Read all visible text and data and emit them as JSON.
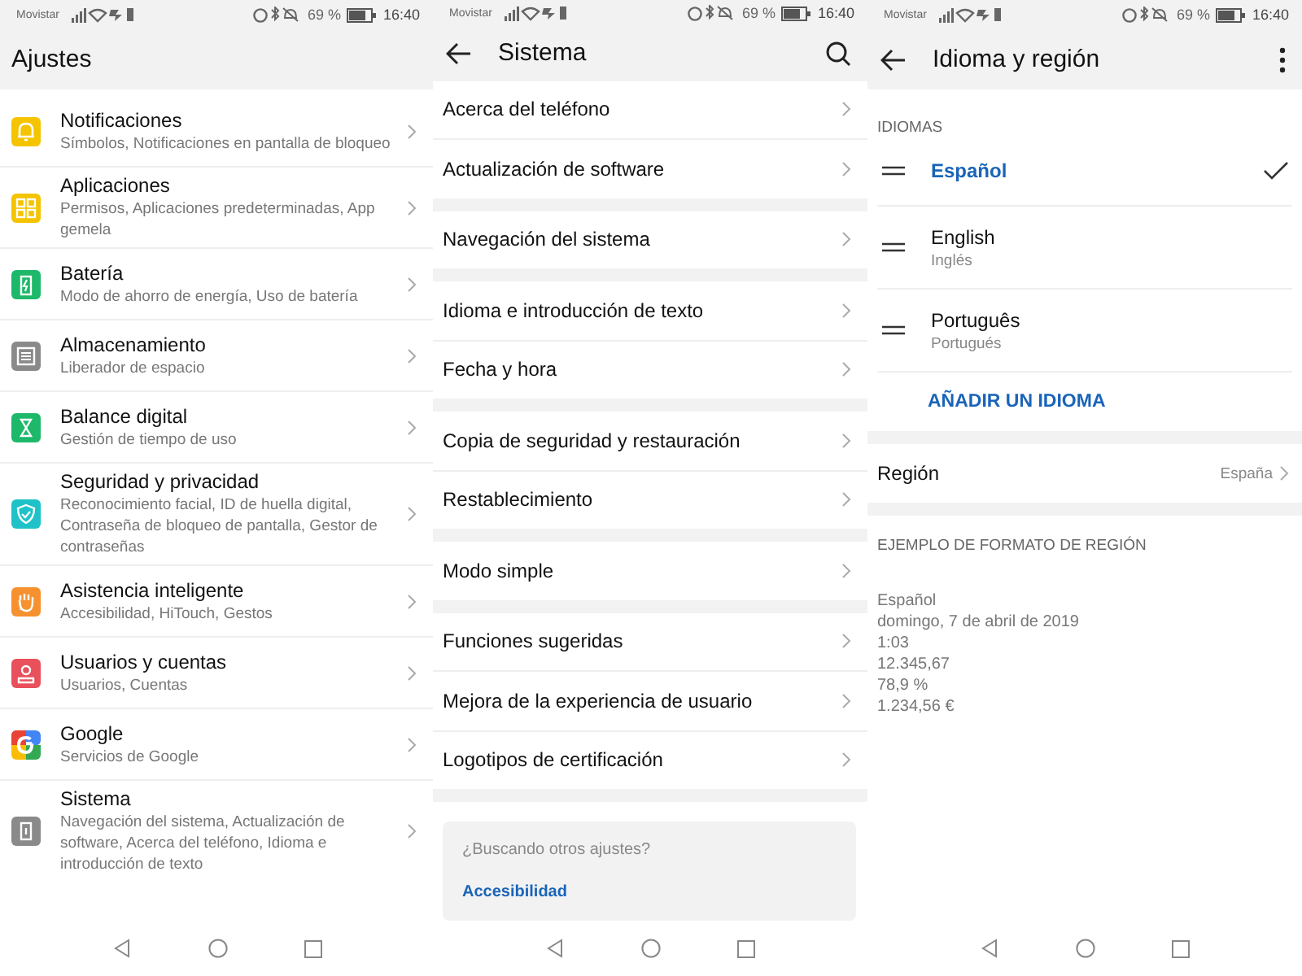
{
  "settings_screen": {
    "status_bar": {
      "carrier": "Movistar",
      "battery": "69 %",
      "time": "16:40"
    },
    "title": "Ajustes",
    "items": [
      {
        "title": "Notificaciones",
        "subtitle": "Símbolos, Notificaciones en pantalla de bloqueo",
        "kind": "bell",
        "color": "#f5c400"
      },
      {
        "title": "Aplicaciones",
        "subtitle": "Permisos, Aplicaciones predeterminadas, App gemela",
        "kind": "apps",
        "color": "#f5c400"
      },
      {
        "title": "Batería",
        "subtitle": "Modo de ahorro de energía, Uso de batería",
        "kind": "battery",
        "color": "#1db86a"
      },
      {
        "title": "Almacenamiento",
        "subtitle": "Liberador de espacio",
        "kind": "storage",
        "color": "#8a8a8a"
      },
      {
        "title": "Balance digital",
        "subtitle": "Gestión de tiempo de uso",
        "kind": "hourglass",
        "color": "#1db86a"
      },
      {
        "title": "Seguridad y privacidad",
        "subtitle": "Reconocimiento facial, ID de huella digital, Contraseña de bloqueo de pantalla, Gestor de contraseñas",
        "kind": "shield",
        "color": "#1ec2c8"
      },
      {
        "title": "Asistencia inteligente",
        "subtitle": "Accesibilidad, HiTouch, Gestos",
        "kind": "hand",
        "color": "#f5922f"
      },
      {
        "title": "Usuarios y cuentas",
        "subtitle": "Usuarios, Cuentas",
        "kind": "user",
        "color": "#e8505b"
      },
      {
        "title": "Google",
        "subtitle": "Servicios de Google",
        "kind": "google",
        "color": "#4285f4"
      },
      {
        "title": "Sistema",
        "subtitle": "Navegación del sistema, Actualización de software, Acerca del teléfono, Idioma e introducción de texto",
        "kind": "phone",
        "color": "#8a8a8a"
      }
    ]
  },
  "system_screen": {
    "status_bar": {
      "carrier": "Movistar",
      "battery": "69 %",
      "time": "16:40"
    },
    "title": "Sistema",
    "groups": [
      [
        "Acerca del teléfono",
        "Actualización de software"
      ],
      [
        "Navegación del sistema"
      ],
      [
        "Idioma e introducción de texto",
        "Fecha y hora"
      ],
      [
        "Copia de seguridad y restauración",
        "Restablecimiento"
      ],
      [
        "Modo simple"
      ],
      [
        "Funciones sugeridas",
        "Mejora de la experiencia de usuario",
        "Logotipos de certificación"
      ]
    ],
    "suggestion": {
      "question": "¿Buscando otros ajustes?",
      "link": "Accesibilidad"
    }
  },
  "language_screen": {
    "status_bar": {
      "carrier": "Movistar",
      "battery": "69 %",
      "time": "16:40"
    },
    "title": "Idioma y región",
    "languages_heading": "IDIOMAS",
    "languages": [
      {
        "name": "Español",
        "selected": true
      },
      {
        "name": "English",
        "translation": "Inglés",
        "selected": false
      },
      {
        "name": "Português",
        "translation": "Portugués",
        "selected": false
      }
    ],
    "add_language": "AÑADIR UN IDIOMA",
    "region": {
      "label": "Región",
      "value": "España"
    },
    "example_heading": "EJEMPLO DE FORMATO DE REGIÓN",
    "example_lines": [
      "Español",
      "domingo, 7 de abril de 2019",
      "1:03",
      "12.345,67",
      "78,9 %",
      "1.234,56 €"
    ]
  }
}
